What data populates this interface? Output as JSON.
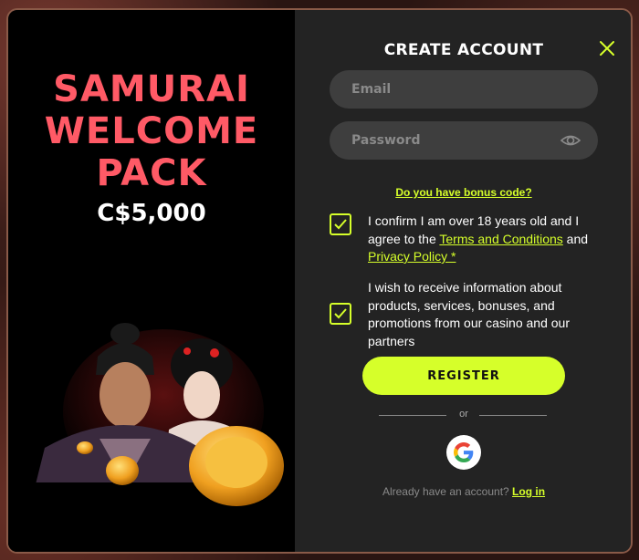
{
  "promo": {
    "title_lines": [
      "SAMURAI",
      "WELCOME",
      "PACK"
    ],
    "amount": "C$5,000"
  },
  "form": {
    "title": "CREATE ACCOUNT",
    "email_placeholder": "Email",
    "password_placeholder": "Password",
    "bonus_link": "Do you have bonus code?",
    "consent_age_prefix": "I confirm I am over 18 years old and I agree to the ",
    "terms_link": "Terms and Conditions",
    "consent_and": " and ",
    "privacy_link": "Privacy Policy *",
    "consent_marketing": "I wish to receive information about products, services, bonuses, and promotions from our casino and our partners",
    "register_label": "REGISTER",
    "or_label": "or",
    "login_prompt": "Already have an account? ",
    "login_link": "Log in"
  },
  "colors": {
    "accent": "#d6ff2a",
    "promo_red": "#ff5a66",
    "panel": "#232323",
    "field": "#3e3e3e"
  },
  "icons": [
    "close-icon",
    "eye-icon",
    "checkmark-icon",
    "google-icon"
  ]
}
